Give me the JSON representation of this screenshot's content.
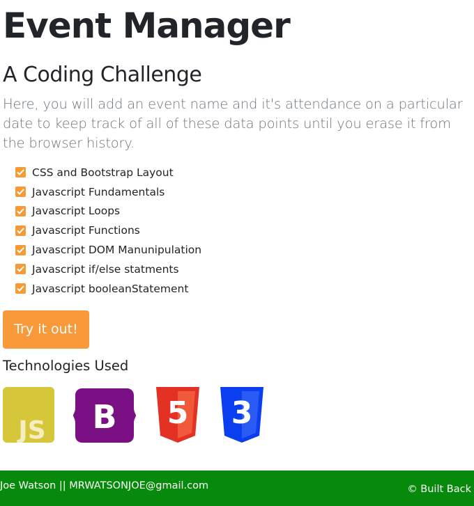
{
  "header": {
    "title": "Event Manager",
    "subtitle": "A Coding Challenge",
    "lead": "Here, you will add an event name and it's attendance on a particular date to keep track of all of these data points until you erase it from the browser history."
  },
  "checklist": {
    "items": [
      {
        "label": "CSS and Bootstrap Layout",
        "checked": true
      },
      {
        "label": "Javascript Fundamentals",
        "checked": true
      },
      {
        "label": "Javascript Loops",
        "checked": true
      },
      {
        "label": "Javascript Functions",
        "checked": true
      },
      {
        "label": "Javascript DOM Manunipulation",
        "checked": true
      },
      {
        "label": "Javascript if/else statments",
        "checked": true
      },
      {
        "label": "Javascript booleanStatement",
        "checked": true
      }
    ]
  },
  "cta": {
    "label": "Try it out!"
  },
  "technologies": {
    "heading": "Technologies Used",
    "logos": [
      {
        "icon": "javascript-logo-icon",
        "text": "JS",
        "color": "#d6c63a"
      },
      {
        "icon": "bootstrap-logo-icon",
        "text": "B",
        "color": "#7b0f84"
      },
      {
        "icon": "html5-logo-icon",
        "text": "5",
        "color": "#e33124"
      },
      {
        "icon": "css3-logo-icon",
        "text": "3",
        "color": "#0a3ff0"
      }
    ]
  },
  "footer": {
    "left_text": "Joe Watson || MRWATSONJOE@gmail.com",
    "right_text": "© Built Back",
    "background": "#078a0b"
  },
  "colors": {
    "accent": "#f8993a",
    "muted_text": "#6c757d"
  }
}
